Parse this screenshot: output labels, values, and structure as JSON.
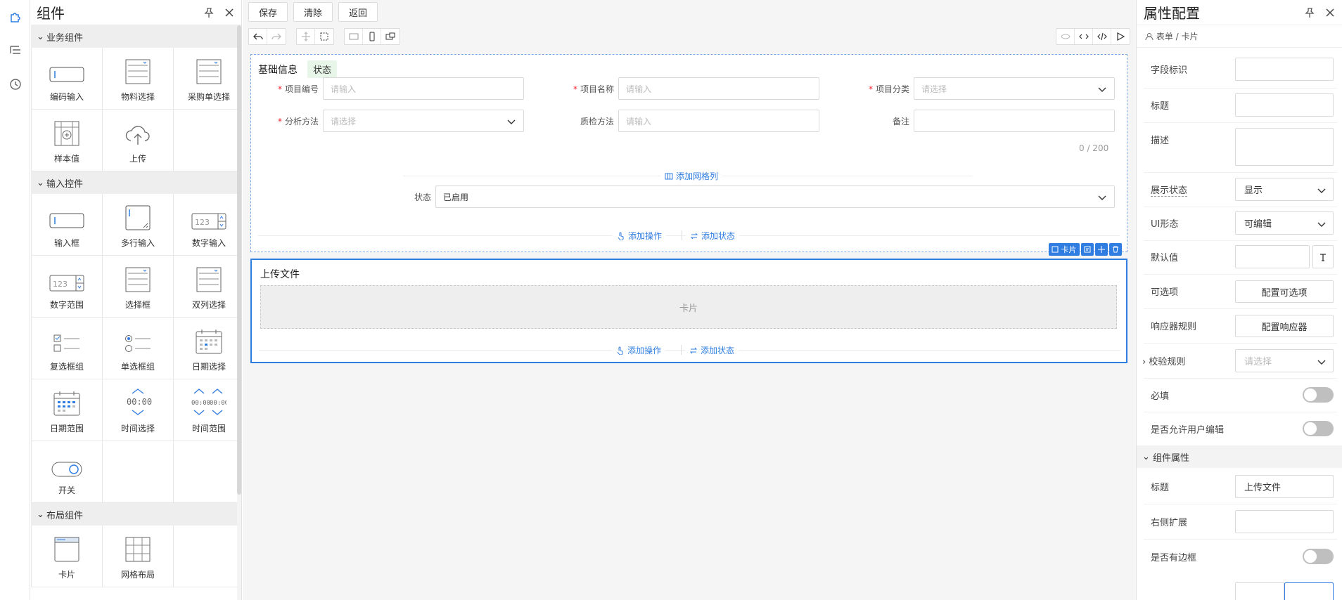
{
  "left_panel": {
    "title": "组件",
    "sections": [
      {
        "title": "业务组件",
        "items": [
          {
            "label": "编码输入",
            "icon": "coded-input-icon"
          },
          {
            "label": "物料选择",
            "icon": "material-select-icon"
          },
          {
            "label": "采购单选择",
            "icon": "purchase-order-select-icon"
          },
          {
            "label": "样本值",
            "icon": "sample-value-icon"
          },
          {
            "label": "上传",
            "icon": "upload-cloud-icon"
          }
        ]
      },
      {
        "title": "输入控件",
        "items": [
          {
            "label": "输入框",
            "icon": "input-box-icon"
          },
          {
            "label": "多行输入",
            "icon": "textarea-icon"
          },
          {
            "label": "数字输入",
            "icon": "number-input-icon"
          },
          {
            "label": "数字范围",
            "icon": "number-range-icon"
          },
          {
            "label": "选择框",
            "icon": "select-box-icon"
          },
          {
            "label": "双列选择",
            "icon": "dual-column-select-icon"
          },
          {
            "label": "复选框组",
            "icon": "checkbox-group-icon"
          },
          {
            "label": "单选框组",
            "icon": "radio-group-icon"
          },
          {
            "label": "日期选择",
            "icon": "date-picker-icon"
          },
          {
            "label": "日期范围",
            "icon": "date-range-icon"
          },
          {
            "label": "时间选择",
            "icon": "time-picker-icon"
          },
          {
            "label": "时间范围",
            "icon": "time-range-icon"
          },
          {
            "label": "开关",
            "icon": "switch-icon"
          }
        ]
      },
      {
        "title": "布局组件",
        "items": [
          {
            "label": "卡片",
            "icon": "card-layout-icon"
          },
          {
            "label": "网格布局",
            "icon": "grid-layout-icon"
          }
        ]
      }
    ]
  },
  "toolbar": {
    "save": "保存",
    "clear": "清除",
    "back": "返回"
  },
  "form": {
    "title": "基础信息",
    "tag": "状态",
    "fields": {
      "project_no": {
        "label": "项目编号",
        "placeholder": "请输入"
      },
      "project_name": {
        "label": "项目名称",
        "placeholder": "请输入"
      },
      "project_category": {
        "label": "项目分类",
        "placeholder": "请选择"
      },
      "analysis_method": {
        "label": "分析方法",
        "placeholder": "请选择"
      },
      "qc_method": {
        "label": "质检方法",
        "placeholder": "请输入"
      },
      "remark": {
        "label": "备注",
        "counter": "0 / 200"
      },
      "status": {
        "label": "状态",
        "value": "已启用"
      }
    },
    "add_grid_column": "添加网格列",
    "add_action": "添加操作",
    "add_state": "添加状态"
  },
  "upload_card": {
    "title": "上传文件",
    "placeholder": "卡片",
    "add_action": "添加操作",
    "add_state": "添加状态",
    "toolbar_label": "卡片"
  },
  "right_panel": {
    "title": "属性配置",
    "breadcrumb": {
      "root": "表单",
      "sep": "/",
      "current": "卡片"
    },
    "props": {
      "field_id": "字段标识",
      "title": "标题",
      "description": "描述",
      "display_state": {
        "label": "展示状态",
        "value": "显示"
      },
      "ui_mode": {
        "label": "UI形态",
        "value": "可编辑"
      },
      "default_value": "默认值",
      "options": {
        "label": "可选项",
        "button": "配置可选项"
      },
      "responder": {
        "label": "响应器规则",
        "button": "配置响应器"
      },
      "validation": {
        "label": "校验规则",
        "placeholder": "请选择"
      },
      "required": "必填",
      "user_editable": "是否允许用户编辑"
    },
    "component_section": "组件属性",
    "component_props": {
      "title": {
        "label": "标题",
        "value": "上传文件"
      },
      "right_ext": "右侧扩展",
      "bordered": "是否有边框"
    }
  }
}
